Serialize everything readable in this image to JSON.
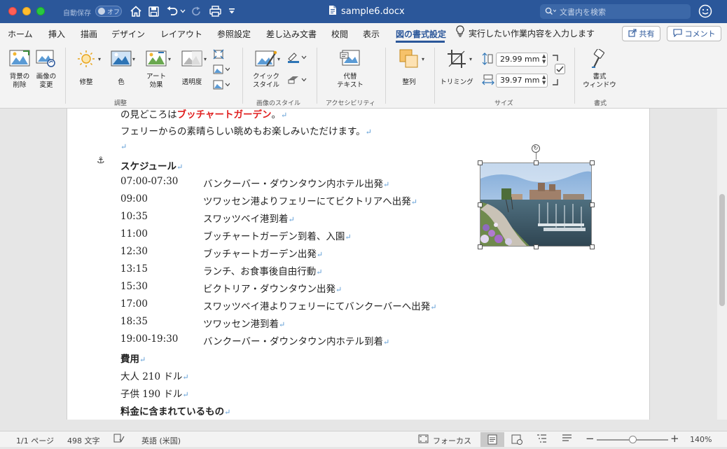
{
  "titlebar": {
    "autosave_label": "自動保存",
    "autosave_state": "オフ",
    "doc_title": "sample6.docx",
    "search_placeholder": "文書内を検索"
  },
  "ribbon_tabs": [
    "ホーム",
    "挿入",
    "描画",
    "デザイン",
    "レイアウト",
    "参照設定",
    "差し込み文書",
    "校閲",
    "表示",
    "図の書式設定"
  ],
  "tell_me": "実行したい作業内容を入力します",
  "share_label": "共有",
  "comment_label": "コメント",
  "ribbon": {
    "remove_bg": "背景の\n削除",
    "change_picture": "画像の\n変更",
    "corrections": "修整",
    "color": "色",
    "artistic": "アート\n効果",
    "transparency": "透明度",
    "adjust_group": "調整",
    "quick_styles": "クイック\nスタイル",
    "picture_styles_group": "画像のスタイル",
    "alt_text": "代替\nテキスト",
    "accessibility_group": "アクセシビリティ",
    "arrange": "整列",
    "crop": "トリミング",
    "height_value": "29.99 mm",
    "width_value": "39.97 mm",
    "size_group": "サイズ",
    "format_pane": "書式\nウィンドウ",
    "format_group": "書式"
  },
  "document": {
    "intro_prefix": "の見どころは",
    "intro_highlight": "ブッチャートガーデン",
    "intro_suffix": "。",
    "ferry_line": "フェリーからの素晴らしい眺めもお楽しみいただけます。",
    "schedule_heading": "スケジュール",
    "schedule": [
      {
        "time": "07:00-07:30",
        "desc": "バンクーバー・ダウンタウン内ホテル出発"
      },
      {
        "time": "09:00",
        "desc": "ツワッセン港よりフェリーにてビクトリアへ出発"
      },
      {
        "time": "10:35",
        "desc": "スワッツベイ港到着"
      },
      {
        "time": "11:00",
        "desc": "ブッチャートガーデン到着、入園"
      },
      {
        "time": "12:30",
        "desc": "ブッチャートガーデン出発"
      },
      {
        "time": "13:15",
        "desc": "ランチ、お食事後自由行動"
      },
      {
        "time": "15:30",
        "desc": "ビクトリア・ダウンタウン出発"
      },
      {
        "time": "17:00",
        "desc": "スワッツベイ港よりフェリーにてバンクーバーへ出発"
      },
      {
        "time": "18:35",
        "desc": "ツワッセン港到着"
      },
      {
        "time": "19:00-19:30",
        "desc": "バンクーバー・ダウンタウン内ホテル到着"
      }
    ],
    "cost_heading": "費用",
    "adult_cost": "大人 210 ドル",
    "child_cost": "子供 190 ドル",
    "included_heading": "料金に含まれているもの",
    "para_mark": "↵"
  },
  "statusbar": {
    "page": "1/1 ページ",
    "words": "498 文字",
    "language": "英語 (米国)",
    "focus": "フォーカス",
    "zoom": "140%",
    "zoom_level": 0.5
  }
}
